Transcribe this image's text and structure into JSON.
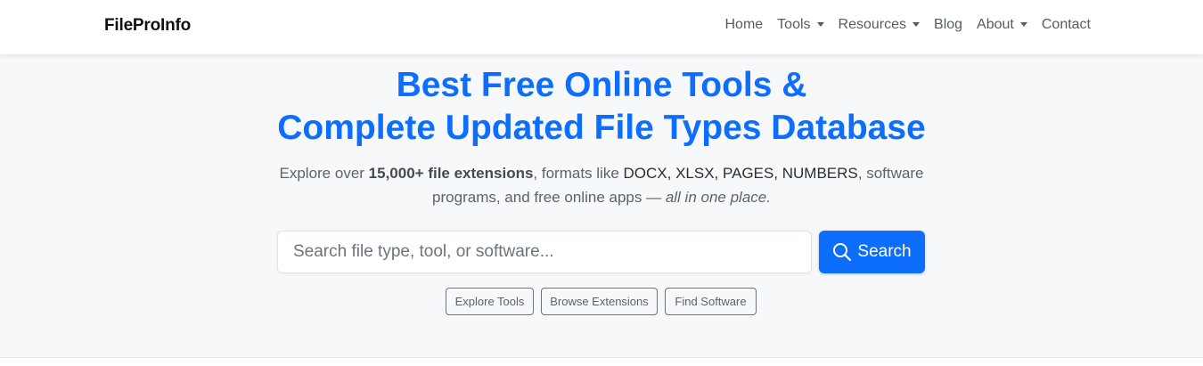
{
  "navbar": {
    "brand": "FileProInfo",
    "items": [
      {
        "label": "Home",
        "dropdown": false
      },
      {
        "label": "Tools",
        "dropdown": true
      },
      {
        "label": "Resources",
        "dropdown": true
      },
      {
        "label": "Blog",
        "dropdown": false
      },
      {
        "label": "About",
        "dropdown": true
      },
      {
        "label": "Contact",
        "dropdown": false
      }
    ]
  },
  "hero": {
    "title_line1": "Best Free Online Tools &",
    "title_line2": "Complete Updated File Types Database",
    "subtitle": {
      "part1": "Explore over ",
      "bold": "15,000+ file extensions",
      "part2": ", formats like ",
      "formats": "DOCX, XLSX, PAGES, NUMBERS",
      "part3": ", software",
      "line2": "programs, and free online apps — ",
      "italic": "all in one place."
    },
    "search": {
      "placeholder": "Search file type, tool, or software...",
      "value": "",
      "button_label": "Search"
    },
    "quick_links": [
      {
        "label": "Explore Tools"
      },
      {
        "label": "Browse Extensions"
      },
      {
        "label": "Find Software"
      }
    ]
  },
  "colors": {
    "primary": "#0d6efd",
    "hero_background": "#f7f8f9",
    "navbar_background": "#ffffff"
  },
  "icons": {
    "search_button_icon": "search-icon",
    "dropdown_icon": "caret-down-icon"
  }
}
